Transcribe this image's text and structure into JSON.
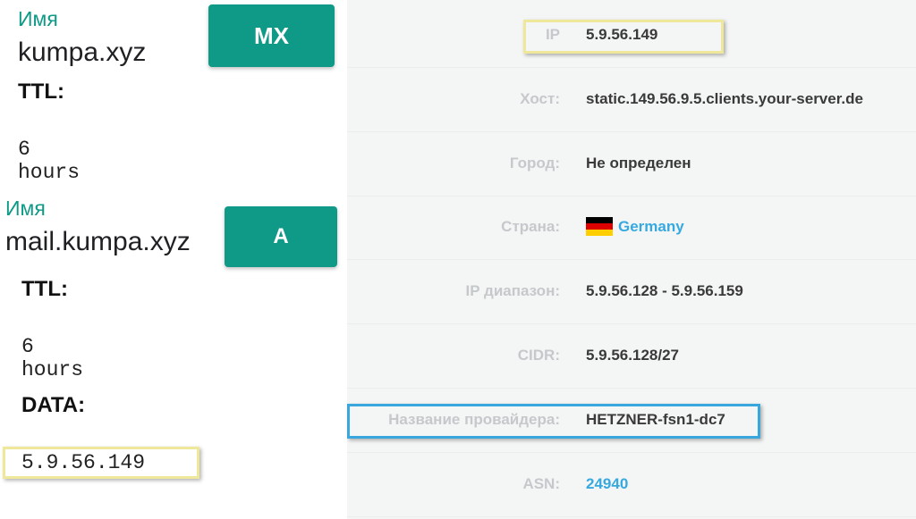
{
  "records": [
    {
      "name_label": "Имя",
      "name": "kumpa.xyz",
      "type": "MX",
      "ttl_label": "TTL:",
      "ttl_value": "6 hours"
    },
    {
      "name_label": "Имя",
      "name": "mail.kumpa.xyz",
      "type": "A",
      "ttl_label": "TTL:",
      "ttl_value": "6 hours",
      "data_label": "DATA:",
      "data_value": "5.9.56.149"
    }
  ],
  "ip_info": [
    {
      "key": "IP",
      "value": "5.9.56.149"
    },
    {
      "key": "Хост:",
      "value": "static.149.56.9.5.clients.your-server.de"
    },
    {
      "key": "Город:",
      "value": "Не определен"
    },
    {
      "key": "Страна:",
      "value": "Germany"
    },
    {
      "key": "IP диапазон:",
      "value": "5.9.56.128 - 5.9.56.159"
    },
    {
      "key": "CIDR:",
      "value": "5.9.56.128/27"
    },
    {
      "key": "Название провайдера:",
      "value": "HETZNER-fsn1-dc7"
    },
    {
      "key": "ASN:",
      "value": "24940"
    }
  ],
  "colors": {
    "accent": "#0f9a87",
    "link": "#36a9e0",
    "highlight_yellow": "#efe79a",
    "highlight_blue": "#3aa6de"
  },
  "icons": {
    "country_flag": "germany-flag-icon"
  }
}
